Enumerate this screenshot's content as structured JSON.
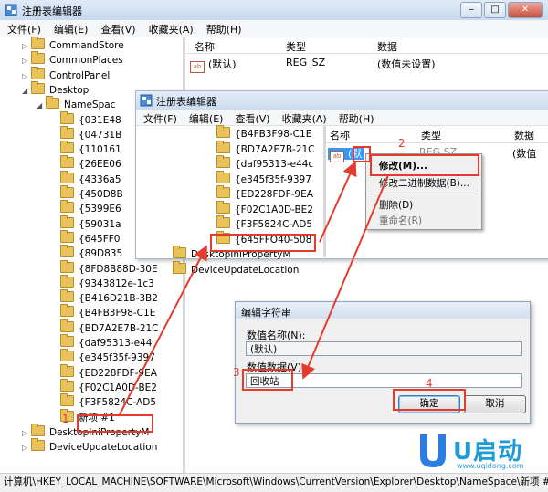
{
  "main_window": {
    "title": "注册表编辑器",
    "menu": [
      "文件(F)",
      "编辑(E)",
      "查看(V)",
      "收藏夹(A)",
      "帮助(H)"
    ],
    "tree": [
      {
        "label": "CommandStore",
        "indent": 1
      },
      {
        "label": "CommonPlaces",
        "indent": 1
      },
      {
        "label": "ControlPanel",
        "indent": 1
      },
      {
        "label": "Desktop",
        "indent": 1
      },
      {
        "label": "NameSpac",
        "indent": 2
      },
      {
        "label": "{031E48",
        "indent": 3
      },
      {
        "label": "{04731B",
        "indent": 3
      },
      {
        "label": "{110161",
        "indent": 3
      },
      {
        "label": "{26EE06",
        "indent": 3
      },
      {
        "label": "{4336a5",
        "indent": 3
      },
      {
        "label": "{450D8B",
        "indent": 3
      },
      {
        "label": "{5399E6",
        "indent": 3
      },
      {
        "label": "{59031a",
        "indent": 3
      },
      {
        "label": "{645FF0",
        "indent": 3
      },
      {
        "label": "{89D835",
        "indent": 3
      },
      {
        "label": "{8FD8B88D-30E",
        "indent": 3
      },
      {
        "label": "{9343812e-1c3",
        "indent": 3
      },
      {
        "label": "{B416D21B-3B2",
        "indent": 3
      },
      {
        "label": "{B4FB3F98-C1E",
        "indent": 3
      },
      {
        "label": "{BD7A2E7B-21C",
        "indent": 3
      },
      {
        "label": "{daf95313-e44",
        "indent": 3
      },
      {
        "label": "{e345f35f-9397",
        "indent": 3
      },
      {
        "label": "{ED228FDF-9EA",
        "indent": 3
      },
      {
        "label": "{F02C1A0D-BE2",
        "indent": 3
      },
      {
        "label": "{F3F5824C-AD5",
        "indent": 3
      },
      {
        "label": "新项 #1",
        "indent": 3
      },
      {
        "label": "DesktopIniPropertyM",
        "indent": 1
      },
      {
        "label": "DeviceUpdateLocation",
        "indent": 1
      }
    ],
    "list_headers": {
      "name": "名称",
      "type": "类型",
      "data": "数据"
    },
    "list_row": {
      "name": "(默认)",
      "type": "REG_SZ",
      "data": "(数值未设置)"
    },
    "status_path": "计算机\\HKEY_LOCAL_MACHINE\\SOFTWARE\\Microsoft\\Windows\\CurrentVersion\\Explorer\\Desktop\\NameSpace\\新项 #1"
  },
  "second_window": {
    "title": "注册表编辑器",
    "menu": [
      "文件(F)",
      "编辑(E)",
      "查看(V)",
      "收藏夹(A)",
      "帮助(H)"
    ],
    "tree": [
      "{B4FB3F98-C1E",
      "{BD7A2E7B-21C",
      "{daf95313-e44c",
      "{e345f35f-9397",
      "{ED228FDF-9EA",
      "{F02C1A0D-BE2",
      "{F3F5824C-AD5",
      "{645FFO40-508",
      "DesktopIniPropertyM",
      "DeviceUpdateLocation"
    ],
    "list_headers": {
      "name": "名称",
      "type": "类型",
      "data": "数据"
    },
    "list_row": {
      "name": "(默",
      "type": "REG SZ",
      "data": "(数值"
    }
  },
  "context_menu": {
    "items": [
      "修改(M)...",
      "修改二进制数据(B)...",
      "删除(D)",
      "重命名(R)"
    ]
  },
  "dialog": {
    "title": "编辑字符串",
    "name_label": "数值名称(N):",
    "name_value": "(默认)",
    "data_label": "数值数据(V):",
    "data_value": "回收站",
    "ok": "确定",
    "cancel": "取消"
  },
  "annotations": [
    "1",
    "2",
    "3",
    "4"
  ],
  "watermark": {
    "brand": "U启动",
    "url": "www.uqidong.com"
  },
  "colors": {
    "highlight": "#e53b2e",
    "folder": "#e9c35a",
    "selection": "#3399ff"
  }
}
